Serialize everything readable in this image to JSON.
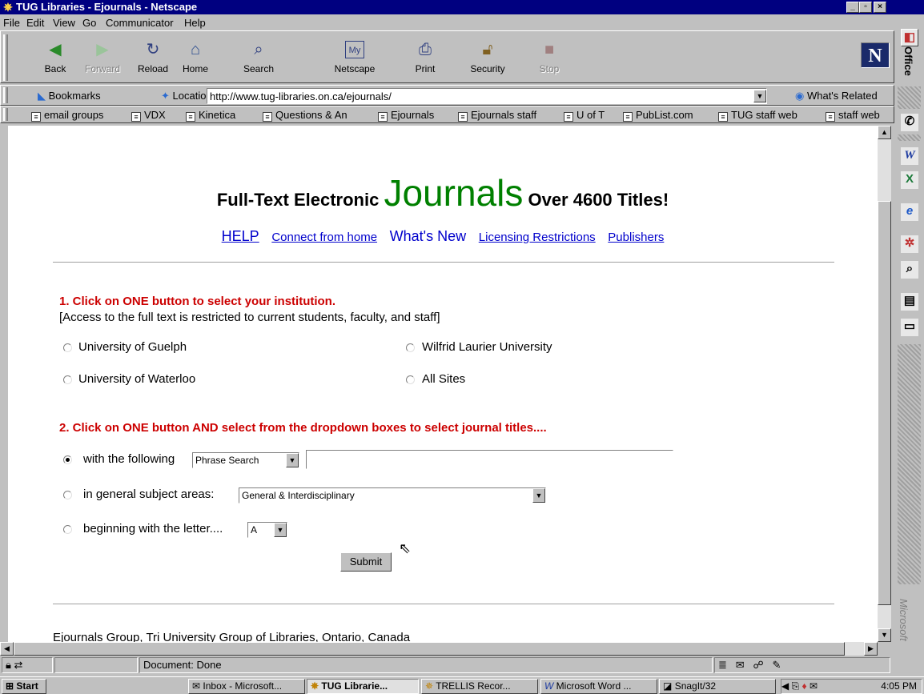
{
  "window": {
    "title": "TUG Libraries - Ejournals - Netscape"
  },
  "menu": [
    "File",
    "Edit",
    "View",
    "Go",
    "Communicator",
    "Help"
  ],
  "toolbar": {
    "back": "Back",
    "forward": "Forward",
    "reload": "Reload",
    "home": "Home",
    "search": "Search",
    "netscape": "Netscape",
    "print": "Print",
    "security": "Security",
    "stop": "Stop"
  },
  "location": {
    "bookmarks": "Bookmarks",
    "label": "Location:",
    "url": "http://www.tug-libraries.on.ca/ejournals/",
    "related": "What's Related"
  },
  "personal_toolbar": [
    "email groups",
    "VDX",
    "Kinetica",
    "Questions & An",
    "Ejournals",
    "Ejournals staff",
    "U of T",
    "PubList.com",
    "TUG staff web",
    "staff web"
  ],
  "page": {
    "heading_pre": "Full-Text Electronic",
    "heading_big": "Journals",
    "heading_post": "Over 4600 Titles!",
    "links": [
      "HELP",
      "Connect from home",
      "What's New",
      "Licensing Restrictions",
      "Publishers"
    ],
    "step1_heading": "1. Click on ONE button to select your institution.",
    "step1_note": "[Access to the full text is restricted to current students, faculty, and staff]",
    "institutions": [
      "University of Guelph",
      "Wilfrid Laurier University",
      "University of Waterloo",
      "All Sites"
    ],
    "step2_heading": "2. Click on ONE button AND select from the dropdown boxes to select journal titles....",
    "option_following": "with the following",
    "search_type": "Phrase Search",
    "option_subject": "in general subject areas:",
    "subject_value": "General & Interdisciplinary",
    "option_letter": "beginning with the letter....",
    "letter_value": "A",
    "submit": "Submit",
    "footer": "Ejournals Group, Tri University Group of Libraries, Ontario, Canada"
  },
  "status": {
    "text": "Document: Done"
  },
  "officebar": {
    "label": "Office",
    "brand": "Microsoft"
  },
  "taskbar": {
    "start": "Start",
    "tasks": [
      "Inbox - Microsoft...",
      "TUG Librarie...",
      "TRELLIS Recor...",
      "Microsoft Word ...",
      "SnagIt/32"
    ],
    "clock": "4:05 PM"
  },
  "colors": {
    "title_bar": "#000080",
    "step_heading": "#cc0000",
    "journals_accent": "#008000",
    "link": "#0000cc"
  }
}
